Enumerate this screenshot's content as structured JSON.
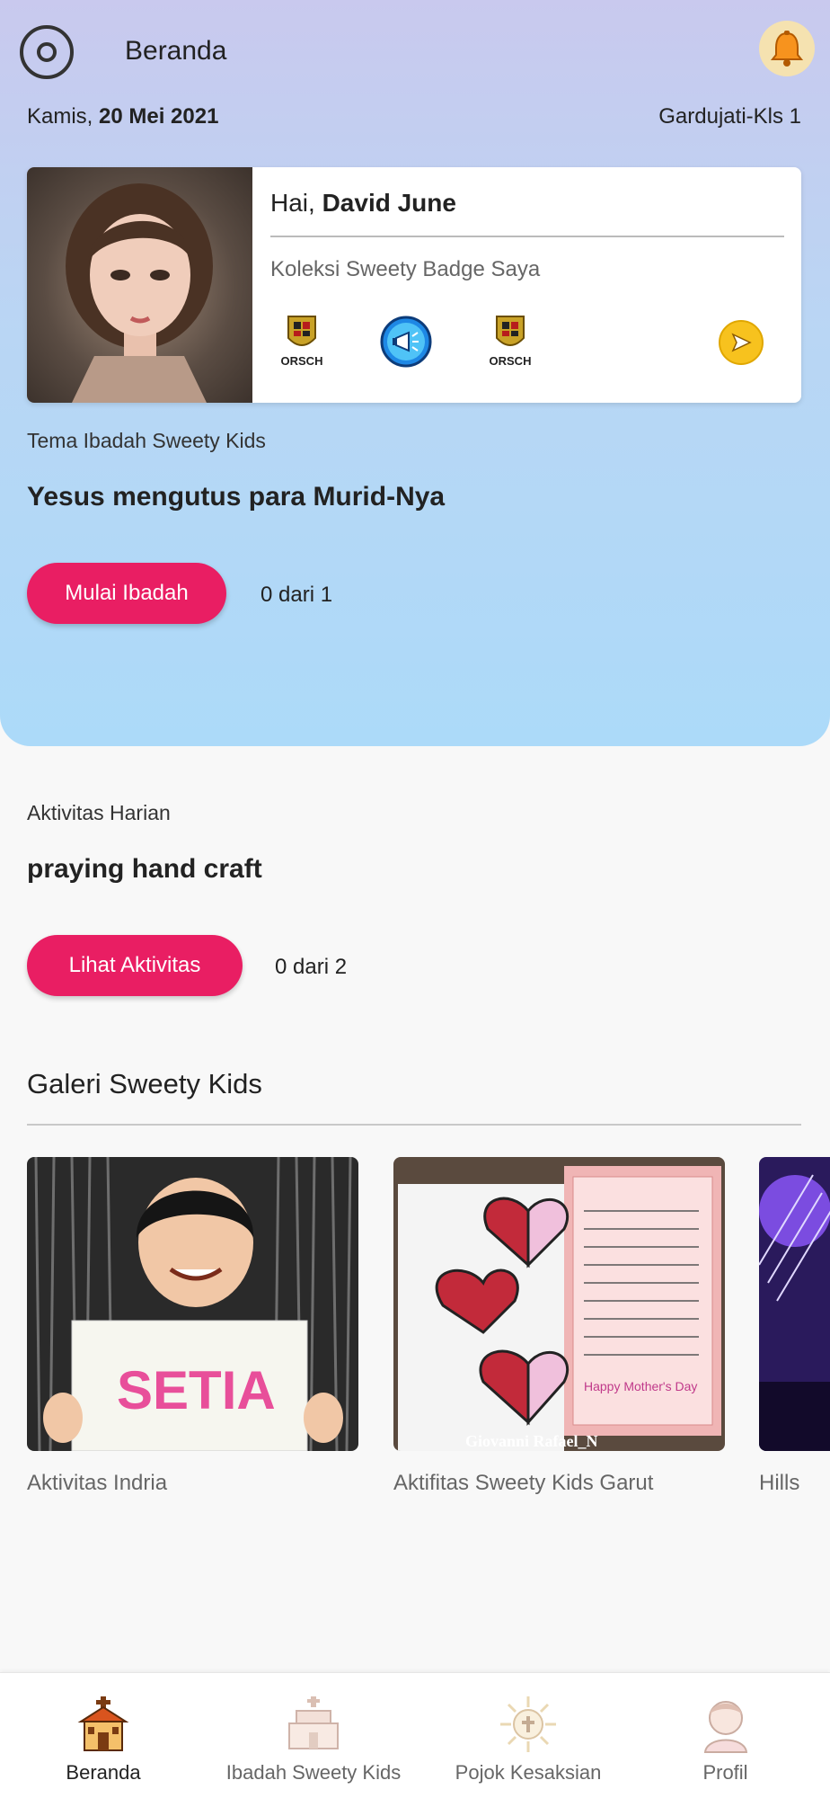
{
  "header": {
    "title": "Beranda"
  },
  "date": {
    "weekday": "Kamis, ",
    "date": "20 Mei 2021"
  },
  "class_label": "Gardujati-Kls 1",
  "profile": {
    "greeting": "Hai, ",
    "name": "David June",
    "badge_title": "Koleksi Sweety Badge Saya",
    "badges": [
      {
        "icon": "porsche-crest-icon",
        "caption": "ORSCH"
      },
      {
        "icon": "megaphone-badge-icon",
        "caption": ""
      },
      {
        "icon": "porsche-crest-icon",
        "caption": "ORSCH"
      }
    ]
  },
  "theme": {
    "caption": "Tema Ibadah Sweety Kids",
    "title": "Yesus mengutus para Murid-Nya",
    "button": "Mulai Ibadah",
    "progress": "0 dari 1"
  },
  "activity": {
    "caption": "Aktivitas Harian",
    "title": "praying hand craft",
    "button": "Lihat Aktivitas",
    "progress": "0 dari 2"
  },
  "gallery": {
    "title": "Galeri Sweety Kids",
    "items": [
      {
        "caption": "Aktivitas Indria",
        "image_text": "SETIA"
      },
      {
        "caption": "Aktifitas Sweety Kids Garut",
        "image_text": "Giovanni Rafael_N",
        "image_text2": "Happy Mother's Day"
      },
      {
        "caption": "Hills"
      }
    ]
  },
  "bottom_nav": [
    {
      "label": "Beranda",
      "icon": "church-icon",
      "active": true
    },
    {
      "label": "Ibadah Sweety Kids",
      "icon": "church-cake-icon",
      "active": false
    },
    {
      "label": "Pojok Kesaksian",
      "icon": "sun-cross-icon",
      "active": false
    },
    {
      "label": "Profil",
      "icon": "child-avatar-icon",
      "active": false
    }
  ],
  "colors": {
    "accent": "#e91e63",
    "hero_top": "#c9c9ee",
    "hero_bottom": "#acdaf9"
  }
}
